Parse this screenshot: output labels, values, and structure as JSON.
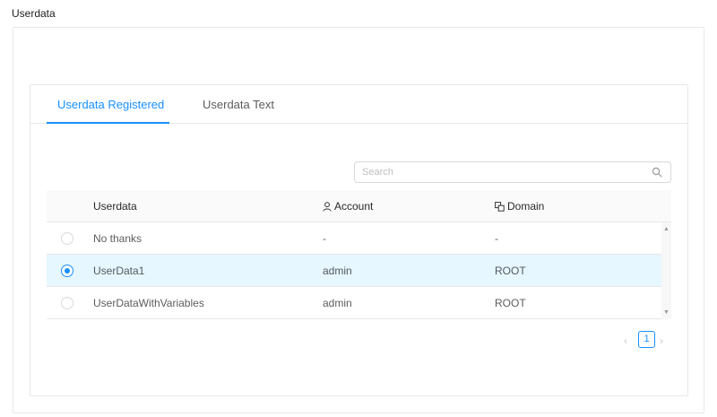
{
  "page": {
    "title": "Userdata"
  },
  "tabs": [
    {
      "label": "Userdata Registered",
      "active": true
    },
    {
      "label": "Userdata Text",
      "active": false
    }
  ],
  "search": {
    "placeholder": "Search",
    "value": ""
  },
  "table": {
    "columns": {
      "userdata": "Userdata",
      "account": "Account",
      "domain": "Domain"
    },
    "rows": [
      {
        "name": "No thanks",
        "account": "-",
        "domain": "-",
        "selected": false
      },
      {
        "name": "UserData1",
        "account": "admin",
        "domain": "ROOT",
        "selected": true
      },
      {
        "name": "UserDataWithVariables",
        "account": "admin",
        "domain": "ROOT",
        "selected": false
      }
    ]
  },
  "pagination": {
    "current": "1",
    "prev": "‹",
    "next": "›"
  },
  "colors": {
    "accent": "#1890ff",
    "selected_row": "#e6f7ff",
    "border": "#e8e8e8"
  }
}
